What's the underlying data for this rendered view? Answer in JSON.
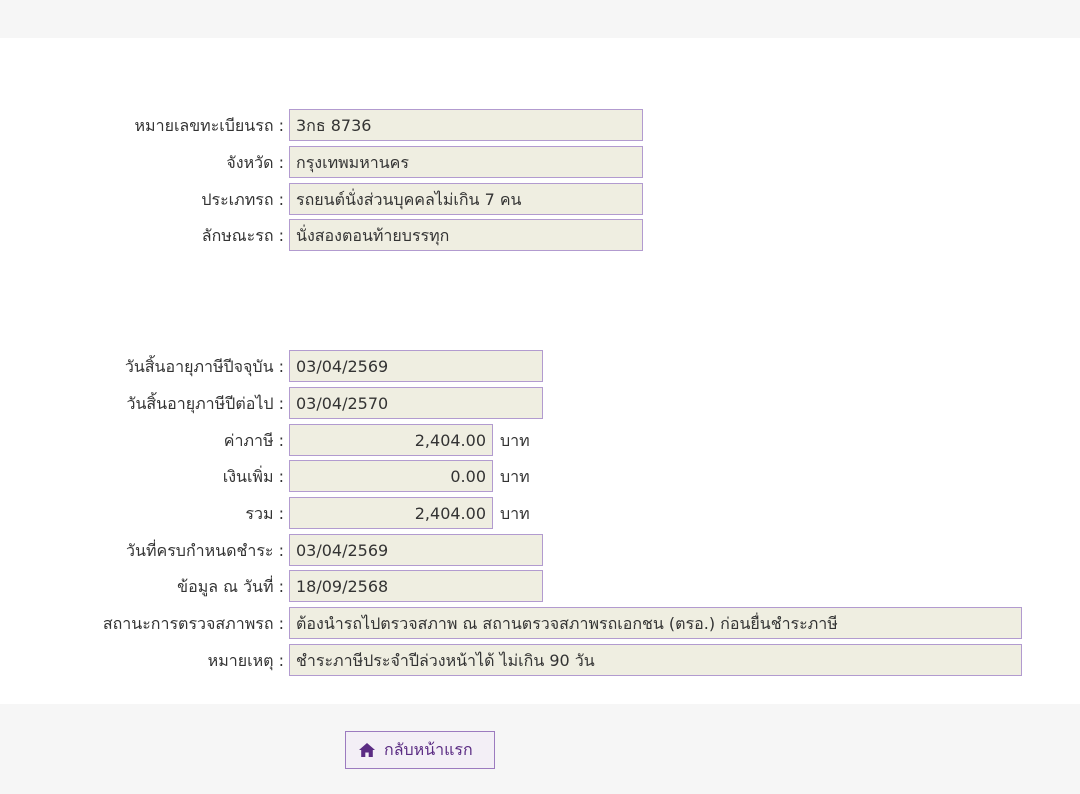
{
  "vehicle": {
    "plate_label": "หมายเลขทะเบียนรถ :",
    "plate_value": "3กธ 8736",
    "province_label": "จังหวัด :",
    "province_value": "กรุงเทพมหานคร",
    "type_label": "ประเภทรถ :",
    "type_value": "รถยนต์นั่งส่วนบุคคลไม่เกิน 7 คน",
    "style_label": "ลักษณะรถ :",
    "style_value": "นั่งสองตอนท้ายบรรทุก"
  },
  "tax": {
    "current_expiry_label": "วันสิ้นอายุภาษีปีจจุบัน :",
    "current_expiry_value": "03/04/2569",
    "next_expiry_label": "วันสิ้นอายุภาษีปีต่อไป :",
    "next_expiry_value": "03/04/2570",
    "tax_label": "ค่าภาษี :",
    "tax_value": "2,404.00",
    "surcharge_label": "เงินเพิ่ม :",
    "surcharge_value": "0.00",
    "total_label": "รวม :",
    "total_value": "2,404.00",
    "unit": "บาท",
    "due_date_label": "วันที่ครบกำหนดชำระ :",
    "due_date_value": "03/04/2569",
    "data_date_label": "ข้อมูล ณ วันที่ :",
    "data_date_value": "18/09/2568",
    "inspection_label": "สถานะการตรวจสภาพรถ :",
    "inspection_value": "ต้องนำรถไปตรวจสภาพ ณ สถานตรวจสภาพรถเอกชน (ตรอ.) ก่อนยื่นชำระภาษี",
    "note_label": "หมายเหตุ :",
    "note_value": "ชำระภาษีประจำปีล่วงหน้าได้ ไม่เกิน 90 วัน"
  },
  "footer": {
    "home_label": "กลับหน้าแรก",
    "home_icon": "home-icon"
  },
  "colors": {
    "field_bg": "#efeee1",
    "field_border": "#b29bcf",
    "button_text": "#5b2c83"
  }
}
